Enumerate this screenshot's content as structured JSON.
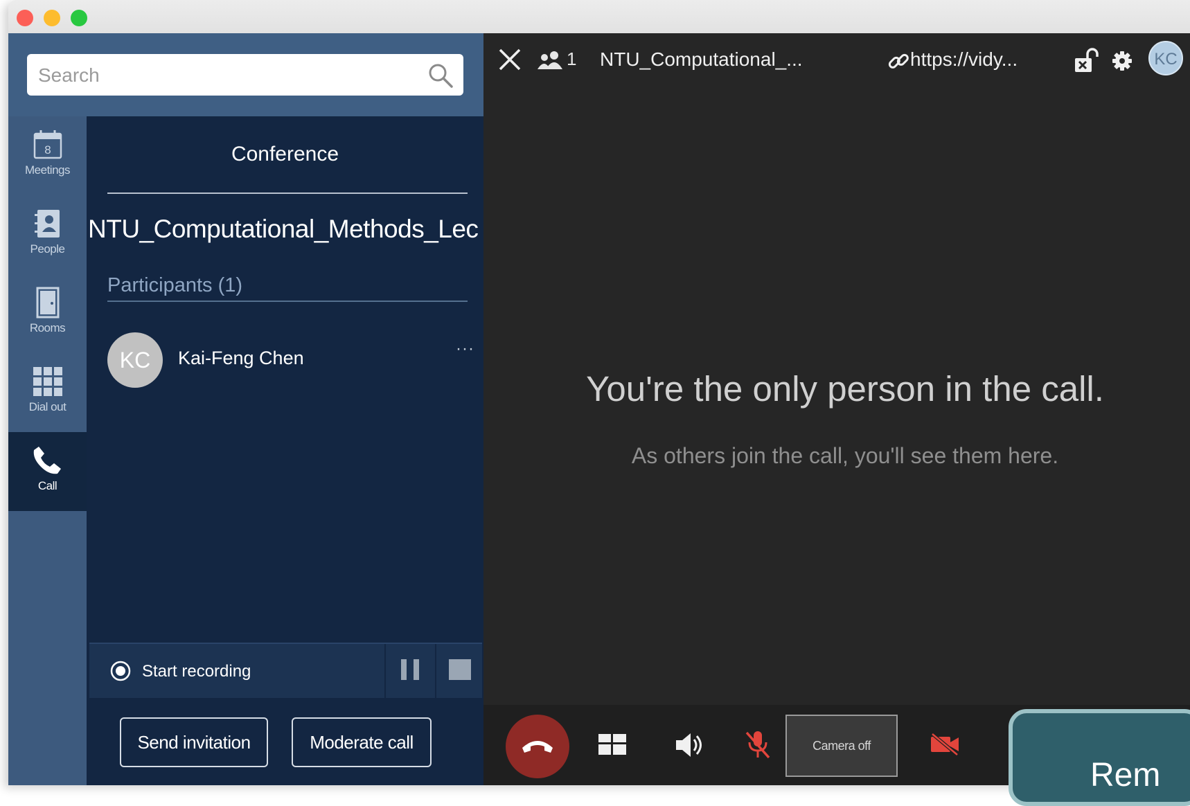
{
  "search": {
    "placeholder": "Search"
  },
  "sidebar": {
    "items": [
      {
        "label": "Meetings",
        "icon": "calendar-icon",
        "active": false
      },
      {
        "label": "People",
        "icon": "contacts-book-icon",
        "active": false
      },
      {
        "label": "Rooms",
        "icon": "door-icon",
        "active": false
      },
      {
        "label": "Dial out",
        "icon": "dialpad-icon",
        "active": false
      },
      {
        "label": "Call",
        "icon": "phone-icon",
        "active": true
      }
    ],
    "calendar_day": "8"
  },
  "conference": {
    "title": "Conference",
    "name": "NTU_Computational_Methods_Lec",
    "participants_label": "Participants (1)",
    "participants": [
      {
        "initials": "KC",
        "name": "Kai-Feng Chen",
        "more": "···"
      }
    ],
    "recording": {
      "start_label": "Start recording"
    },
    "send_invitation": "Send invitation",
    "moderate_call": "Moderate call"
  },
  "call": {
    "participant_count": "1",
    "title": "NTU_Computational_...",
    "url": "https://vidy...",
    "user_initials": "KC",
    "empty_title": "You're the only person in the call.",
    "empty_subtitle": "As others join the call, you'll see them here.",
    "camera_label": "Camera off"
  },
  "overlay": {
    "text": "Rem"
  },
  "colors": {
    "sidebar": "#3d5a7e",
    "panel": "#132642",
    "main": "#262626",
    "hangup": "#8f2a26",
    "muted_red": "#e2453c"
  }
}
